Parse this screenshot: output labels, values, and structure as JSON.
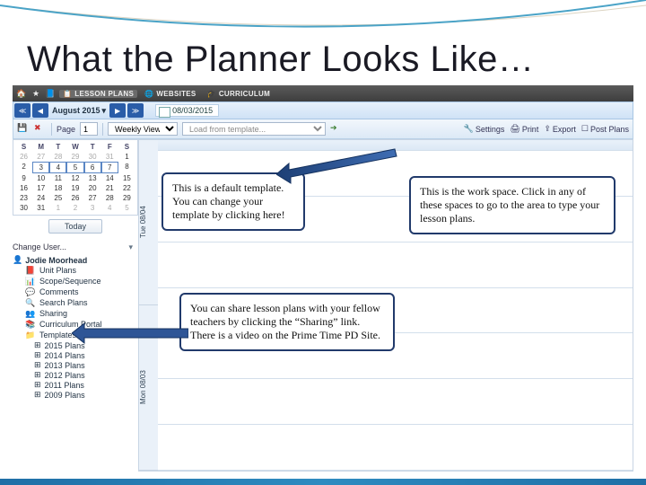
{
  "slide": {
    "title": "What the Planner Looks Like…"
  },
  "topnav": {
    "items": [
      {
        "name": "home-icon",
        "label": ""
      },
      {
        "name": "star-icon",
        "label": ""
      },
      {
        "name": "book-icon",
        "label": ""
      },
      {
        "name": "plans-icon",
        "label": "LESSON PLANS",
        "active": true
      },
      {
        "name": "globe-icon",
        "label": "WEBSITES"
      },
      {
        "name": "cap-icon",
        "label": "CURRICULUM"
      }
    ]
  },
  "subbar": {
    "prev_fast": "≪",
    "prev": "◀",
    "month_label": "August 2015",
    "next": "▶",
    "next_fast": "≫",
    "date_tab": "08/03/2015"
  },
  "toolbar": {
    "page_label": "Page",
    "page_value": "1",
    "view_label": "Weekly View",
    "template_placeholder": "Load from template...",
    "links": {
      "settings": "Settings",
      "print": "Print",
      "export": "Export",
      "post": "Post Plans"
    }
  },
  "calendar": {
    "dow": [
      "S",
      "M",
      "T",
      "W",
      "T",
      "F",
      "S"
    ],
    "rows": [
      [
        "26",
        "27",
        "28",
        "29",
        "30",
        "31",
        "1"
      ],
      [
        "2",
        "3",
        "4",
        "5",
        "6",
        "7",
        "8"
      ],
      [
        "9",
        "10",
        "11",
        "12",
        "13",
        "14",
        "15"
      ],
      [
        "16",
        "17",
        "18",
        "19",
        "20",
        "21",
        "22"
      ],
      [
        "23",
        "24",
        "25",
        "26",
        "27",
        "28",
        "29"
      ],
      [
        "30",
        "31",
        "1",
        "2",
        "3",
        "4",
        "5"
      ]
    ],
    "today_label": "Today"
  },
  "change_user": "Change User...",
  "tree": {
    "root": "Jodie Moorhead",
    "items": [
      "Unit Plans",
      "Scope/Sequence",
      "Comments",
      "Search Plans",
      "Sharing",
      "Curriculum Portal",
      "Templates",
      "2015 Plans",
      "2014 Plans",
      "2013 Plans",
      "2012 Plans",
      "2011 Plans",
      "2009 Plans"
    ]
  },
  "workspace": {
    "day_labels": [
      "Mon 08/03",
      "Tue 08/04"
    ]
  },
  "callouts": {
    "template": "This is a default template. You can change your template by clicking here!",
    "workspace": "This is the work space. Click in any of these spaces to go to the area to type your lesson plans.",
    "sharing": "You can share lesson plans with your fellow teachers by clicking the “Sharing” link. There is a video on the Prime Time PD Site."
  },
  "colors": {
    "accent": "#213a6b",
    "banner": "#1f6fa6"
  }
}
